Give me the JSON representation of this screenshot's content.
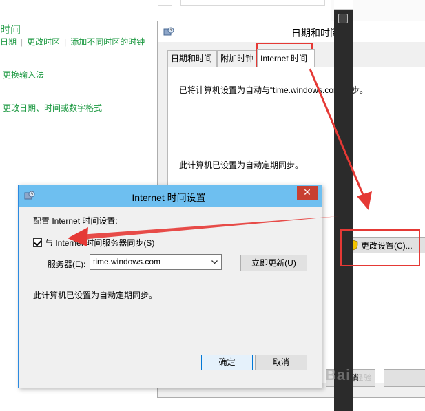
{
  "background": {
    "heading": "时间",
    "links": [
      "日期",
      "更改时区",
      "添加不同时区的时钟"
    ],
    "link_input": "更换输入法",
    "link_format": "更改日期、时间或数字格式"
  },
  "datetime_window": {
    "title": "日期和时间",
    "tabs": [
      "日期和时间",
      "附加时钟",
      "Internet 时间"
    ],
    "active_tab": "Internet 时间",
    "sync_text": "已将计算机设置为自动与“time.windows.com”同步。",
    "auto_text": "此计算机已设置为自动定期同步。",
    "change_settings_label": "更改设置(C)...",
    "cancel_label": "取消"
  },
  "internet_time_dialog": {
    "title": "Internet 时间设置",
    "close_label": "✕",
    "config_label": "配置 Internet 时间设置:",
    "sync_checkbox_label": "与 Internet 时间服务器同步(S)",
    "sync_checked": true,
    "server_label": "服务器(E):",
    "server_value": "time.windows.com",
    "update_now_label": "立即更新(U)",
    "status_text": "此计算机已设置为自动定期同步。",
    "ok_label": "确定",
    "cancel_label": "取消"
  },
  "annotations": {
    "highlight_color": "#e53935"
  },
  "watermark": {
    "text": "Bai",
    "text2": "经验"
  }
}
